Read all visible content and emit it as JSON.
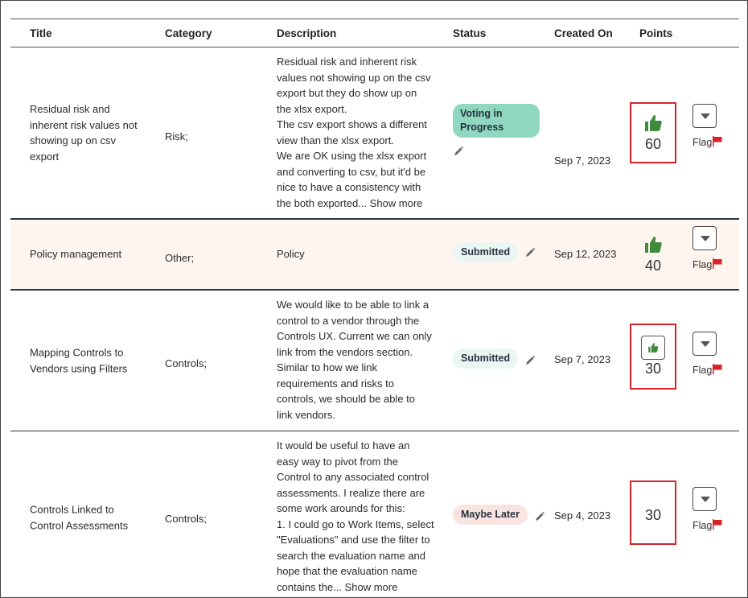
{
  "columns": {
    "title": "Title",
    "category": "Category",
    "description": "Description",
    "status": "Status",
    "created_on": "Created On",
    "points": "Points"
  },
  "rows": [
    {
      "title_lines": [
        "Residual risk and",
        "inherent risk values not",
        "showing up on csv",
        "export"
      ],
      "category": "Risk;",
      "desc_lines": [
        "Residual risk and inherent risk",
        "values not showing up on the csv",
        "export but they do show up on",
        "the xlsx export.",
        "The csv export shows a different",
        "view than the xlsx export.",
        "We are OK using the xlsx export",
        "and converting to csv, but it'd be",
        "nice to have a consistency with",
        "the both exported..."
      ],
      "show_more": "Show more",
      "status": "Voting in Progress",
      "created_on": "Sep 7, 2023",
      "points": "60",
      "flag": "Flag"
    },
    {
      "title_lines": [
        "Policy management"
      ],
      "category": "Other;",
      "desc_lines": [
        "Policy"
      ],
      "status": "Submitted",
      "created_on": "Sep 12, 2023",
      "points": "40",
      "flag": "Flag"
    },
    {
      "title_lines": [
        "Mapping Controls to",
        "Vendors using Filters"
      ],
      "category": "Controls;",
      "desc_lines": [
        "We would like to be able to link a",
        "control to a vendor through the",
        "Controls UX. Current we can only",
        "link from the vendors section.",
        "Similar to how we link",
        "requirements and risks to",
        "controls, we should be able to",
        "link vendors."
      ],
      "status": "Submitted",
      "created_on": "Sep 7, 2023",
      "points": "30",
      "flag": "Flag"
    },
    {
      "title_lines": [
        "Controls Linked to",
        "Control Assessments"
      ],
      "category": "Controls;",
      "desc_lines": [
        "It would be useful to have an",
        "easy way to pivot from the",
        "Control to any associated control",
        "assessments. I realize there are",
        "some work arounds for this:",
        "1. I could go to Work Items, select",
        "\"Evaluations\" and use the filter to",
        "search the evaluation name and",
        "hope that the evaluation name",
        "contains the..."
      ],
      "show_more": "Show more",
      "status": "Maybe Later",
      "created_on": "Sep 4, 2023",
      "points": "30",
      "flag": "Flag"
    }
  ],
  "icons": {
    "thumb": "thumbs-up-icon",
    "edit": "pencil-icon",
    "flag": "red-flag-icon",
    "menu": "chevron-down-icon"
  },
  "colors": {
    "thumb_green": "#3f8a3c",
    "flag_red": "#d8232a",
    "highlight_box": "#d8232a",
    "voting_badge": "#8fd7be",
    "submitted_badge": "#eaf6f2",
    "later_badge": "#f9e4e2",
    "row_highlight": "#fdf5ee"
  }
}
